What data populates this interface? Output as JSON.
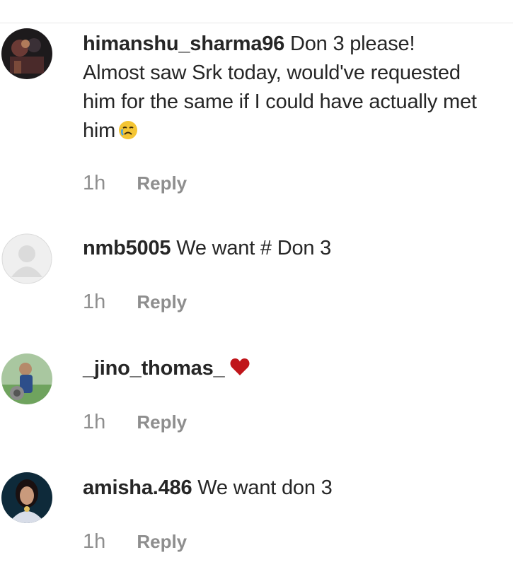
{
  "comments": [
    {
      "username": "himanshu_sharma96",
      "text": "Don 3 please! Almost saw Srk today, would've requested him for the same if I could have actually met him",
      "emoji": "crying-face",
      "time": "1h",
      "reply_label": "Reply"
    },
    {
      "username": "nmb5005",
      "text": "We want # Don 3",
      "time": "1h",
      "reply_label": "Reply"
    },
    {
      "username": "_jino_thomas_",
      "text": "",
      "emoji": "red-heart",
      "time": "1h",
      "reply_label": "Reply"
    },
    {
      "username": "amisha.486",
      "text": "We want don 3",
      "time": "1h",
      "reply_label": "Reply"
    }
  ],
  "colors": {
    "text": "#262626",
    "secondary": "#8e8e8e",
    "divider": "#e6e6e6",
    "heart": "#c0151a"
  }
}
